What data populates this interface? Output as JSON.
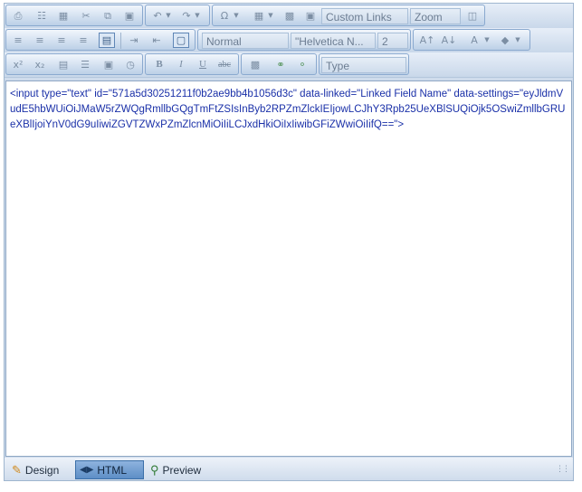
{
  "toolbar1": {
    "buttons": [
      "print-icon",
      "find-icon",
      "select-all-icon",
      "cut-icon",
      "copy-icon",
      "paste-icon",
      "undo-icon",
      "redo-icon",
      "special-chars-icon",
      "table-icon",
      "image-manager-icon",
      "flash-manager-icon",
      "custom-links-icon"
    ],
    "custom_links": "Custom Links",
    "zoom": "Zoom"
  },
  "toolbar2": {
    "paragraph_style": "Normal",
    "font_name": "\"Helvetica N...",
    "font_size": "2"
  },
  "toolbar3": {
    "format_block": "Type",
    "bold": "B",
    "italic": "I",
    "underline": "U",
    "strikethrough": "abc"
  },
  "content": {
    "html_source": "<input type=\"text\" id=\"571a5d30251211f0b2ae9bb4b1056d3c\" data-linked=\"Linked Field Name\" data-settings=\"eyJldmVudE5hbWUiOiJMaW5rZWQgRmllbGQgTmFtZSIsInByb2RPZmZlckIEIjowLCJhY3Rpb25UeXBlSUQiOjk5OSwiZmllbGRUeXBlIjoiYnV0dG9uIiwiZGVTZWxPZmZlcnMiOiIiLCJxdHkiOiIxIiwibGFiZWwiOiIifQ==\">"
  },
  "modes": {
    "design": "Design",
    "html": "HTML",
    "preview": "Preview"
  },
  "colors": {
    "code_text": "#1a30a8",
    "active_mode": "#6e9bd0"
  }
}
